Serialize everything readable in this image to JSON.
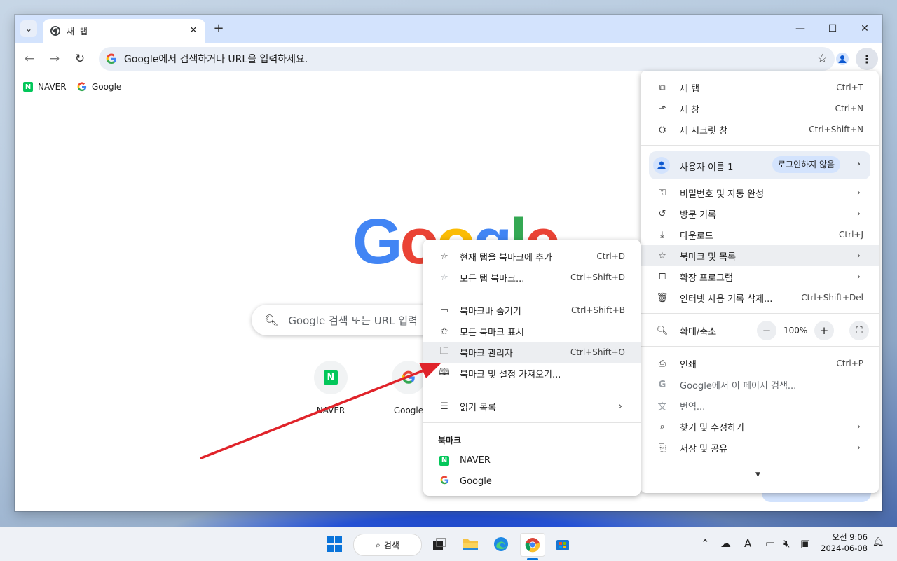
{
  "tab": {
    "title": "새 탭"
  },
  "omnibox": {
    "text": "Google에서 검색하거나 URL을 입력하세요."
  },
  "bookmarks_bar": [
    {
      "label": "NAVER"
    },
    {
      "label": "Google"
    }
  ],
  "newtab": {
    "search_placeholder": "Google 검색 또는 URL 입력",
    "shortcuts": [
      {
        "label": "NAVER"
      },
      {
        "label": "Google"
      }
    ]
  },
  "main_menu": {
    "new_tab": {
      "label": "새 탭",
      "shortcut": "Ctrl+T"
    },
    "new_window": {
      "label": "새 창",
      "shortcut": "Ctrl+N"
    },
    "incognito": {
      "label": "새 시크릿 창",
      "shortcut": "Ctrl+Shift+N"
    },
    "profile": {
      "name": "사용자 이름 1",
      "status": "로그인하지 않음"
    },
    "passwords": {
      "label": "비밀번호 및 자동 완성"
    },
    "history": {
      "label": "방문 기록"
    },
    "downloads": {
      "label": "다운로드",
      "shortcut": "Ctrl+J"
    },
    "bookmarks": {
      "label": "북마크 및 목록"
    },
    "extensions": {
      "label": "확장 프로그램"
    },
    "clear_data": {
      "label": "인터넷 사용 기록 삭제...",
      "shortcut": "Ctrl+Shift+Del"
    },
    "zoom": {
      "label": "확대/축소",
      "minus": "−",
      "value": "100%",
      "plus": "+"
    },
    "print": {
      "label": "인쇄",
      "shortcut": "Ctrl+P"
    },
    "search_page": {
      "label": "Google에서 이 페이지 검색..."
    },
    "translate": {
      "label": "번역..."
    },
    "find_edit": {
      "label": "찾기 및 수정하기"
    },
    "save_share": {
      "label": "저장 및 공유"
    }
  },
  "bookmark_menu": {
    "add_current": {
      "label": "현재 탭을 북마크에 추가",
      "shortcut": "Ctrl+D"
    },
    "bookmark_all": {
      "label": "모든 탭 북마크...",
      "shortcut": "Ctrl+Shift+D"
    },
    "hide_bar": {
      "label": "북마크바 숨기기",
      "shortcut": "Ctrl+Shift+B"
    },
    "show_all": {
      "label": "모든 북마크 표시"
    },
    "manager": {
      "label": "북마크 관리자",
      "shortcut": "Ctrl+Shift+O"
    },
    "import": {
      "label": "북마크 및 설정 가져오기..."
    },
    "reading_list": {
      "label": "읽기 목록"
    },
    "section_header": "북마크",
    "items": [
      {
        "label": "NAVER"
      },
      {
        "label": "Google"
      }
    ]
  },
  "taskbar": {
    "search_label": "검색",
    "time": "오전 9:06",
    "date": "2024-06-08"
  },
  "colors": {
    "accent": "#d3e3fd",
    "annotation_arrow": "#e0232a",
    "naver_green": "#03c75a"
  }
}
